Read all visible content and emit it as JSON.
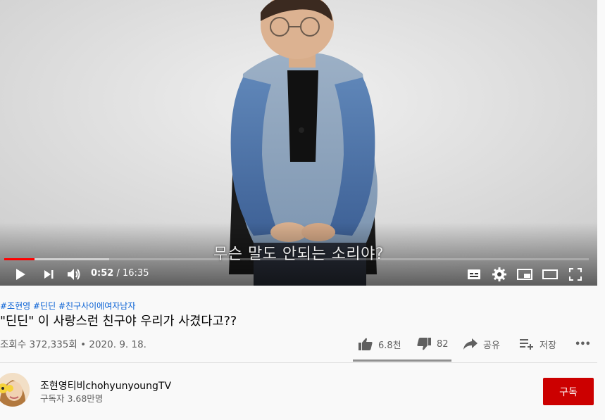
{
  "player": {
    "subtitle": "무슨 말도 안되는 소리야?",
    "current_time": "0:52",
    "separator": " / ",
    "duration": "16:35",
    "progress_fraction": 0.052,
    "buffer_fraction": 0.18,
    "controls": [
      "play-icon",
      "next-icon",
      "volume-icon",
      "subtitles-icon",
      "settings-icon",
      "miniplayer-icon",
      "theater-icon",
      "fullscreen-icon"
    ]
  },
  "video": {
    "tags": "#조현영 #딘딘 #친구사이에여자남자",
    "title": "\"딘딘\" 이 사랑스런 친구야 우리가 사겼다고??",
    "views": "조회수 372,335회",
    "dot": "•",
    "date": "2020. 9. 18."
  },
  "actions": {
    "like_count": "6.8천",
    "dislike_count": "82",
    "share_label": "공유",
    "save_label": "저장",
    "more_label": "•••"
  },
  "channel": {
    "name": "조현영티비chohyunyoungTV",
    "subscribers": "구독자 3.68만명",
    "subscribe_label": "구독"
  },
  "colors": {
    "accent_red": "#ff0000",
    "subscribe_bg": "#cc0000",
    "link_blue": "#065fd4"
  }
}
